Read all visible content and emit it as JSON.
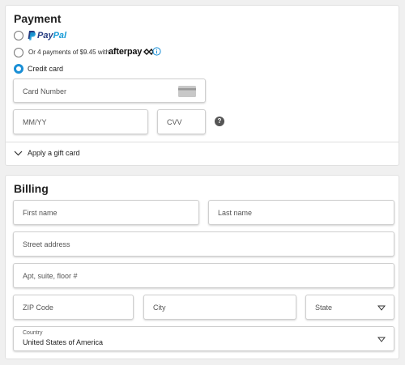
{
  "payment": {
    "title": "Payment",
    "options": [
      {
        "id": "paypal",
        "label_pay": "Pay",
        "label_pal": "Pal",
        "selected": false
      },
      {
        "id": "afterpay",
        "prefix": "Or 4 payments of $9.45 with",
        "brand": "afterpay",
        "selected": false
      },
      {
        "id": "credit",
        "label": "Credit card",
        "selected": true
      }
    ],
    "card_number_placeholder": "Card Number",
    "expiry_placeholder": "MM/YY",
    "cvv_placeholder": "CVV",
    "cvv_help": "?",
    "gift_card_label": "Apply a gift card"
  },
  "billing": {
    "title": "Billing",
    "first_name_placeholder": "First name",
    "last_name_placeholder": "Last name",
    "street_placeholder": "Street address",
    "apt_placeholder": "Apt, suite, floor #",
    "zip_placeholder": "ZIP Code",
    "city_placeholder": "City",
    "state_placeholder": "State",
    "country_label": "Country",
    "country_value": "United States of America"
  },
  "colors": {
    "accent": "#1a8fd6",
    "paypal_dark": "#253b80",
    "paypal_light": "#179bd7",
    "info": "#1a8fd6"
  },
  "icons": [
    "card-icon",
    "info-icon",
    "help-icon",
    "chevron-down-icon",
    "dropdown-arrow-icon",
    "afterpay-loop-icon"
  ]
}
